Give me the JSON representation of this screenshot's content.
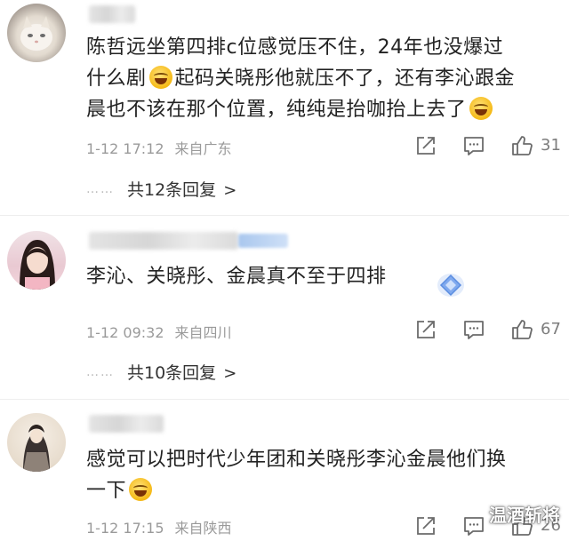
{
  "comments": [
    {
      "text_line1": "陈哲远坐第四排c位感觉压不住，24年也没爆过",
      "text_line2a": "什么剧",
      "text_line2b": "起码关晓彤他就压不了，还有李沁跟金",
      "text_line3": "晨也不该在那个位置，纯纯是抬咖抬上去了",
      "time": "1-12 17:12",
      "location": "来自广东",
      "likes": "31",
      "replies_label": "共12条回复",
      "replies_chevron": ">"
    },
    {
      "text_line1": "李沁、关晓彤、金晨真不至于四排",
      "time": "1-12 09:32",
      "location": "来自四川",
      "likes": "67",
      "replies_label": "共10条回复",
      "replies_chevron": ">"
    },
    {
      "text_line1": "感觉可以把时代少年团和关晓彤李沁金晨他们换",
      "text_line2": "一下",
      "time": "1-12 17:15",
      "location": "来自陕西",
      "likes": "26"
    }
  ],
  "reply_dots": "……",
  "icons": [
    "share-icon",
    "comment-icon",
    "like-icon",
    "laugh-cry-emoji-icon",
    "diamond-badge-icon"
  ],
  "watermark": "温酒斩将",
  "colors": {
    "meta": "#9a9a9a",
    "text": "#222222",
    "divider": "#eeeeee"
  }
}
